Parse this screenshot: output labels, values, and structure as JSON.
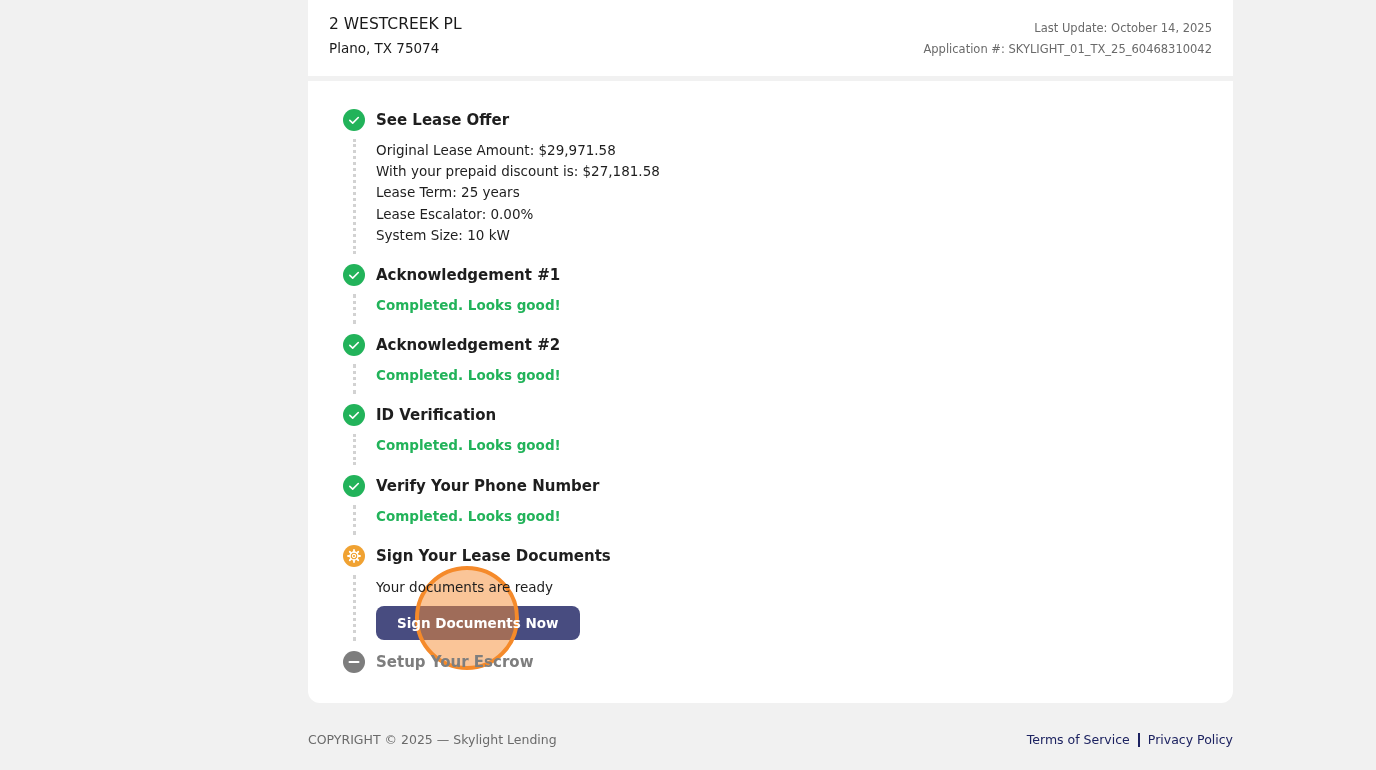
{
  "header": {
    "address_line1": "2 WESTCREEK PL",
    "address_line2": "Plano, TX 75074",
    "last_update": "Last Update: October 14, 2025",
    "application_number": "Application #: SKYLIGHT_01_TX_25_60468310042"
  },
  "steps": [
    {
      "title": "See Lease Offer",
      "kind": "done",
      "lines": [
        {
          "kind": "plain",
          "text": "Original Lease Amount: $29,971.58"
        },
        {
          "kind": "plain",
          "text": "With your prepaid discount is: $27,181.58"
        },
        {
          "kind": "plain",
          "text": "Lease Term: 25 years"
        },
        {
          "kind": "plain",
          "text": "Lease Escalator: 0.00%"
        },
        {
          "kind": "plain",
          "text": "System Size: 10 kW"
        }
      ]
    },
    {
      "title": "Acknowledgement #1",
      "kind": "done",
      "lines": [
        {
          "kind": "success",
          "text": "Completed. Looks good!"
        }
      ]
    },
    {
      "title": "Acknowledgement #2",
      "kind": "done",
      "lines": [
        {
          "kind": "success",
          "text": "Completed. Looks good!"
        }
      ]
    },
    {
      "title": "ID Verification",
      "kind": "done",
      "lines": [
        {
          "kind": "success",
          "text": "Completed. Looks good!"
        }
      ]
    },
    {
      "title": "Verify Your Phone Number",
      "kind": "done",
      "lines": [
        {
          "kind": "success",
          "text": "Completed. Looks good!"
        }
      ]
    },
    {
      "title": "Sign Your Lease Documents",
      "kind": "current",
      "lines": [
        {
          "kind": "plain",
          "text": "Your documents are ready"
        }
      ],
      "button": {
        "label": "Sign Documents Now",
        "click_marker": true
      }
    },
    {
      "title": "Setup Your Escrow",
      "kind": "pending"
    }
  ],
  "footer": {
    "copyright": "COPYRIGHT © 2025 — Skylight Lending",
    "links": [
      "Terms of Service",
      "Privacy Policy"
    ]
  }
}
